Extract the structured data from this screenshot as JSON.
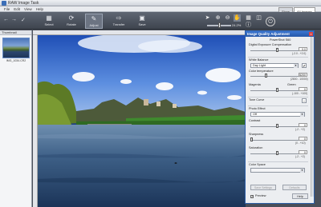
{
  "window": {
    "title": "RAW Image Task"
  },
  "menu": [
    "File",
    "Edit",
    "View",
    "Help"
  ],
  "toolbar": {
    "buttons": [
      {
        "label": "Select",
        "icon": "grid-icon"
      },
      {
        "label": "Rotate",
        "icon": "rotate-icon"
      },
      {
        "label": "Adjust",
        "icon": "adjust-icon"
      },
      {
        "label": "Transfer",
        "icon": "transfer-icon"
      },
      {
        "label": "Save",
        "icon": "save-icon"
      }
    ],
    "zoom": "24.2%"
  },
  "right_tabs": [
    "Show",
    "All Images"
  ],
  "thumbnails": {
    "header": "Thumbnail",
    "caption": "IMG_1034.CR2"
  },
  "dialog": {
    "title": "Image Quality Adjustment",
    "subtitle": "PowerShot S60",
    "exposure": {
      "label": "Digital Exposure Compensation",
      "value": "0.0",
      "range": "(-2.0 - +2.0)"
    },
    "white_balance": {
      "label": "White Balance",
      "value": "Day Light"
    },
    "color_temp": {
      "label": "Color temperature",
      "value": "5200",
      "range": "(2800 - 10000)"
    },
    "magenta": {
      "label": "Magenta",
      "green": "Green",
      "value": "0",
      "range": "(-100 - +100)"
    },
    "tone_curve": {
      "label": "Tone Curve"
    },
    "photo_effect": {
      "label": "Photo Effect",
      "value": "Off"
    },
    "contrast": {
      "label": "Contrast",
      "value": "0",
      "range": "(-2 - +2)"
    },
    "sharpness": {
      "label": "Sharpness",
      "value": "0",
      "range": "(0 - +10)"
    },
    "saturation": {
      "label": "Saturation",
      "value": "0",
      "range": "(-2 - +2)"
    },
    "color_space": {
      "label": "Color Space"
    },
    "save_settings": "Save Settings",
    "defaults": "Defaults",
    "preview": "Preview",
    "help": "Help"
  }
}
